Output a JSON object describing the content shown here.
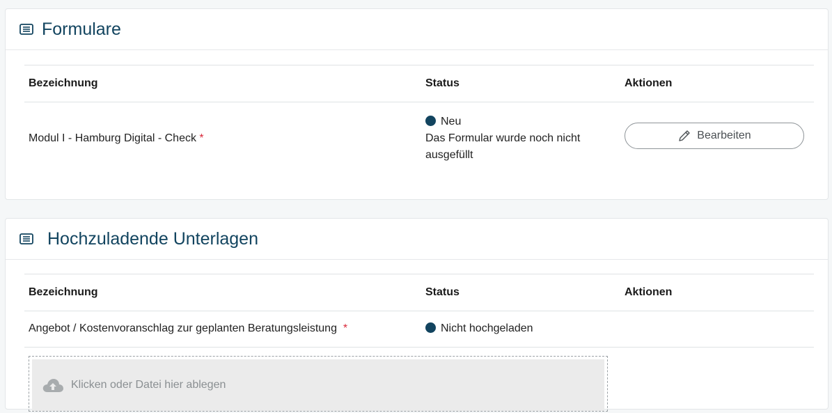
{
  "forms_section": {
    "title": "Formulare",
    "columns": {
      "name": "Bezeichnung",
      "status": "Status",
      "actions": "Aktionen"
    },
    "rows": [
      {
        "name": "Modul I - Hamburg Digital - Check",
        "required_mark": "*",
        "status_label": "Neu",
        "status_description_line1": "Das Formular wurde noch nicht",
        "status_description_line2": "ausgefüllt",
        "action_label": "Bearbeiten"
      }
    ]
  },
  "uploads_section": {
    "title": "Hochzuladende Unterlagen",
    "columns": {
      "name": "Bezeichnung",
      "status": "Status",
      "actions": "Aktionen"
    },
    "rows": [
      {
        "name": "Angebot / Kostenvoranschlag zur geplanten Beratungsleistung",
        "required_mark": "*",
        "status_label": "Nicht hochgeladen"
      }
    ],
    "dropzone_label": "Klicken oder Datei hier ablegen"
  },
  "colors": {
    "accent": "#12445f",
    "required": "#d9293a",
    "status_dot": "#12445f"
  },
  "icons": {
    "section_icon": "list-icon",
    "edit_icon": "pencil-icon",
    "upload_icon": "cloud-upload-icon"
  }
}
